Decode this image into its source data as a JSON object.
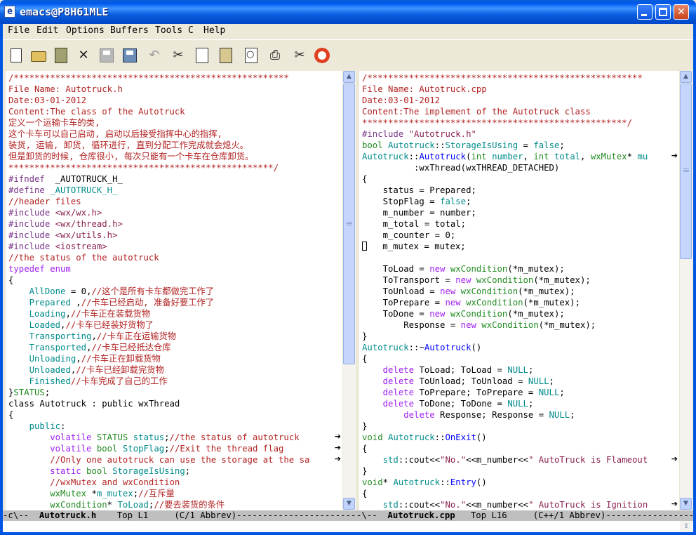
{
  "window": {
    "title": "emacs@P8H61MLE",
    "icon": "emacs-icon"
  },
  "menu": [
    "File",
    "Edit",
    "Options",
    "Buffers",
    "Tools",
    "C",
    "Help"
  ],
  "toolbar": [
    {
      "name": "new-file-icon"
    },
    {
      "name": "open-folder-icon"
    },
    {
      "name": "dired-icon"
    },
    {
      "name": "close-icon",
      "glyph": "✕"
    },
    {
      "name": "save-icon"
    },
    {
      "name": "save-as-icon"
    },
    {
      "name": "undo-icon",
      "glyph": "↶"
    },
    {
      "name": "cut-icon",
      "glyph": "✂"
    },
    {
      "name": "copy-icon"
    },
    {
      "name": "paste-icon"
    },
    {
      "name": "search-icon",
      "glyph": "🔍"
    },
    {
      "name": "print-icon",
      "glyph": "⎙"
    },
    {
      "name": "preferences-icon",
      "glyph": "✂"
    },
    {
      "name": "help-icon"
    }
  ],
  "left_buffer": {
    "lines": [
      [
        [
          "cmt",
          "/*****************************************************"
        ]
      ],
      [
        [
          "cmt",
          "File Name: Autotruck.h"
        ]
      ],
      [
        [
          "cmt",
          "Date:03-01-2012"
        ]
      ],
      [
        [
          "cmt",
          "Content:The class of the Autotruck"
        ]
      ],
      [
        [
          "cmt",
          "定义一个运输卡车的类,"
        ]
      ],
      [
        [
          "cmt",
          "这个卡车可以自己启动, 启动以后接受指挥中心的指挥,"
        ]
      ],
      [
        [
          "cmt",
          "装货, 运输, 卸货, 循环进行, 直到分配工作完成就会熄火。"
        ]
      ],
      [
        [
          "cmt",
          "但是卸货的时候, 仓库很小, 每次只能有一个卡车在仓库卸货。"
        ]
      ],
      [
        [
          "cmt",
          "***************************************************/"
        ]
      ],
      [
        [
          "pp",
          "#ifndef"
        ],
        [
          "",
          "  _AUTOTRUCK_H_"
        ]
      ],
      [
        [
          "pp",
          "#define"
        ],
        [
          "cn",
          " _AUTOTRUCK_H_"
        ]
      ],
      [
        [
          "cmt",
          "//header files"
        ]
      ],
      [
        [
          "pp",
          "#include"
        ],
        [
          "str",
          " <wx/wx.h>"
        ]
      ],
      [
        [
          "pp",
          "#include"
        ],
        [
          "str",
          " <wx/thread.h>"
        ]
      ],
      [
        [
          "pp",
          "#include"
        ],
        [
          "str",
          " <wx/utils.h>"
        ]
      ],
      [
        [
          "pp",
          "#include"
        ],
        [
          "str",
          " <iostream>"
        ]
      ],
      [
        [
          "cmt",
          "//the status of the autotruck"
        ]
      ],
      [
        [
          "kw",
          "typedef enum"
        ]
      ],
      [
        [
          "",
          "{"
        ]
      ],
      [
        [
          "",
          "    "
        ],
        [
          "cn",
          "AllDone"
        ],
        [
          "",
          " = 0,"
        ],
        [
          "cmt",
          "//这个是所有卡车都做完工作了"
        ]
      ],
      [
        [
          "",
          "    "
        ],
        [
          "cn",
          "Prepared"
        ],
        [
          "",
          " ,"
        ],
        [
          "cmt",
          "//卡车已经启动, 准备好要工作了"
        ]
      ],
      [
        [
          "",
          "    "
        ],
        [
          "cn",
          "Loading"
        ],
        [
          "",
          ","
        ],
        [
          "cmt",
          "//卡车正在装载货物"
        ]
      ],
      [
        [
          "",
          "    "
        ],
        [
          "cn",
          "Loaded"
        ],
        [
          "",
          ","
        ],
        [
          "cmt",
          "//卡车已经装好货物了"
        ]
      ],
      [
        [
          "",
          "    "
        ],
        [
          "cn",
          "Transporting"
        ],
        [
          "",
          ","
        ],
        [
          "cmt",
          "//卡车正在运输货物"
        ]
      ],
      [
        [
          "",
          "    "
        ],
        [
          "cn",
          "Transported"
        ],
        [
          "",
          ","
        ],
        [
          "cmt",
          "//卡车已经抵达仓库"
        ]
      ],
      [
        [
          "",
          "    "
        ],
        [
          "cn",
          "Unloading"
        ],
        [
          "",
          ","
        ],
        [
          "cmt",
          "//卡车正在卸载货物"
        ]
      ],
      [
        [
          "",
          "    "
        ],
        [
          "cn",
          "Unloaded"
        ],
        [
          "",
          ","
        ],
        [
          "cmt",
          "//卡车已经卸载完货物"
        ]
      ],
      [
        [
          "",
          "    "
        ],
        [
          "cn",
          "Finished"
        ],
        [
          "",
          ""
        ],
        [
          "cmt",
          "//卡车完成了自己的工作"
        ]
      ],
      [
        [
          "",
          "}"
        ],
        [
          "ty",
          "STATUS"
        ],
        [
          "",
          ";"
        ]
      ],
      [
        [
          "",
          "class Autotruck : public wxThread"
        ]
      ],
      [
        [
          "",
          "{"
        ]
      ],
      [
        [
          "",
          "    "
        ],
        [
          "cn",
          "public"
        ],
        [
          "",
          ":"
        ]
      ],
      [
        [
          "",
          "        "
        ],
        [
          "kw",
          "volatile"
        ],
        [
          "ty",
          " STATUS"
        ],
        [
          "cn",
          " status"
        ],
        [
          "",
          ";"
        ],
        [
          "cmt",
          "//the status of autotruck"
        ]
      ],
      [
        [
          "",
          "        "
        ],
        [
          "kw",
          "volatile"
        ],
        [
          "ty",
          " bool"
        ],
        [
          "cn",
          " StopFlag"
        ],
        [
          "",
          ";"
        ],
        [
          "cmt",
          "//Exit the thread flag"
        ]
      ],
      [
        [
          "",
          "        "
        ],
        [
          "cmt",
          "//Only one autotruck can use the storage at the sa"
        ]
      ],
      [
        [
          "",
          "        "
        ],
        [
          "kw",
          "static"
        ],
        [
          "ty",
          " bool"
        ],
        [
          "cn",
          " StorageIsUsing"
        ],
        [
          "",
          ";"
        ]
      ],
      [
        [
          "",
          "        "
        ],
        [
          "cmt",
          "//wxMutex and wxCondition"
        ]
      ],
      [
        [
          "",
          "        "
        ],
        [
          "ty",
          "wxMutex"
        ],
        [
          "",
          " *"
        ],
        [
          "cn",
          "m_mutex"
        ],
        [
          "",
          ";"
        ],
        [
          "cmt",
          "//互斥量"
        ]
      ],
      [
        [
          "",
          "        "
        ],
        [
          "ty",
          "wxCondition"
        ],
        [
          "",
          "* "
        ],
        [
          "cn",
          "ToLoad"
        ],
        [
          "",
          ";"
        ],
        [
          "cmt",
          "//要去装货的条件"
        ]
      ]
    ],
    "wrapped_lines": [
      32,
      33,
      34
    ]
  },
  "right_buffer": {
    "lines": [
      [
        [
          "cmt",
          "/*****************************************************"
        ]
      ],
      [
        [
          "cmt",
          "File Name: Autotruck.cpp"
        ]
      ],
      [
        [
          "cmt",
          "Date:03-01-2012"
        ]
      ],
      [
        [
          "cmt",
          "Content:The implement of the Autotruck class"
        ]
      ],
      [
        [
          "cmt",
          "***************************************************/"
        ]
      ],
      [
        [
          "pp",
          "#include"
        ],
        [
          "str",
          " \"Autotruck.h\""
        ]
      ],
      [
        [
          "ty",
          "bool"
        ],
        [
          "cn",
          " Autotruck"
        ],
        [
          "",
          "::"
        ],
        [
          "cn",
          "StorageIsUsing"
        ],
        [
          "",
          " = "
        ],
        [
          "cn",
          "false"
        ],
        [
          "",
          ";"
        ]
      ],
      [
        [
          "cn",
          "Autotruck"
        ],
        [
          "",
          "::"
        ],
        [
          "fn",
          "Autotruck"
        ],
        [
          "",
          "("
        ],
        [
          "ty",
          "int"
        ],
        [
          "cn",
          " number"
        ],
        [
          ",",
          ""
        ],
        [
          "",
          ", "
        ],
        [
          "ty",
          "int"
        ],
        [
          "cn",
          " total"
        ],
        [
          "",
          ", "
        ],
        [
          "ty",
          "wxMutex"
        ],
        [
          "",
          "* "
        ],
        [
          "cn",
          "mu"
        ]
      ],
      [
        [
          "",
          "          :wxThread(wxTHREAD_DETACHED)"
        ]
      ],
      [
        [
          "",
          "{"
        ]
      ],
      [
        [
          "",
          "    status = Prepared;"
        ]
      ],
      [
        [
          "",
          "    StopFlag = "
        ],
        [
          "cn",
          "false"
        ],
        [
          "",
          ";"
        ]
      ],
      [
        [
          "",
          "    m_number = number;"
        ]
      ],
      [
        [
          "",
          "    m_total = total;"
        ]
      ],
      [
        [
          "",
          "    m_counter = 0;"
        ]
      ],
      [
        [
          "cursor",
          ""
        ],
        [
          "",
          "   m_mutex = mutex;"
        ]
      ],
      [
        [
          "",
          ""
        ]
      ],
      [
        [
          "",
          "    ToLoad = "
        ],
        [
          "kw",
          "new"
        ],
        [
          "ty",
          " wxCondition"
        ],
        [
          "",
          "(*m_mutex);"
        ]
      ],
      [
        [
          "",
          "    ToTransport = "
        ],
        [
          "kw",
          "new"
        ],
        [
          "ty",
          " wxCondition"
        ],
        [
          "",
          "(*m_mutex);"
        ]
      ],
      [
        [
          "",
          "    ToUnload = "
        ],
        [
          "kw",
          "new"
        ],
        [
          "ty",
          " wxCondition"
        ],
        [
          "",
          "(*m_mutex);"
        ]
      ],
      [
        [
          "",
          "    ToPrepare = "
        ],
        [
          "kw",
          "new"
        ],
        [
          "ty",
          " wxCondition"
        ],
        [
          "",
          "(*m_mutex);"
        ]
      ],
      [
        [
          "",
          "    ToDone = "
        ],
        [
          "kw",
          "new"
        ],
        [
          "ty",
          " wxCondition"
        ],
        [
          "",
          "(*m_mutex);"
        ]
      ],
      [
        [
          "",
          "        Response = "
        ],
        [
          "kw",
          "new"
        ],
        [
          "ty",
          " wxCondition"
        ],
        [
          "",
          "(*m_mutex);"
        ]
      ],
      [
        [
          "",
          "}"
        ]
      ],
      [
        [
          "cn",
          "Autotruck"
        ],
        [
          "",
          "::~"
        ],
        [
          "fn",
          "Autotruck"
        ],
        [
          "",
          "()"
        ]
      ],
      [
        [
          "",
          "{"
        ]
      ],
      [
        [
          "",
          "    "
        ],
        [
          "kw",
          "delete"
        ],
        [
          "",
          " ToLoad; ToLoad = "
        ],
        [
          "cn",
          "NULL"
        ],
        [
          "",
          ";"
        ]
      ],
      [
        [
          "",
          "    "
        ],
        [
          "kw",
          "delete"
        ],
        [
          "",
          " ToUnload; ToUnload = "
        ],
        [
          "cn",
          "NULL"
        ],
        [
          "",
          ";"
        ]
      ],
      [
        [
          "",
          "    "
        ],
        [
          "kw",
          "delete"
        ],
        [
          "",
          " ToPrepare; ToPrepare = "
        ],
        [
          "cn",
          "NULL"
        ],
        [
          "",
          ";"
        ]
      ],
      [
        [
          "",
          "    "
        ],
        [
          "kw",
          "delete"
        ],
        [
          "",
          " ToDone; ToDone = "
        ],
        [
          "cn",
          "NULL"
        ],
        [
          "",
          ";"
        ]
      ],
      [
        [
          "",
          "        "
        ],
        [
          "kw",
          "delete"
        ],
        [
          "",
          " Response; Response = "
        ],
        [
          "cn",
          "NULL"
        ],
        [
          "",
          ";"
        ]
      ],
      [
        [
          "",
          "}"
        ]
      ],
      [
        [
          "ty",
          "void"
        ],
        [
          "cn",
          " Autotruck"
        ],
        [
          "",
          "::"
        ],
        [
          "fn",
          "OnExit"
        ],
        [
          "",
          "()"
        ]
      ],
      [
        [
          "",
          "{"
        ]
      ],
      [
        [
          "",
          "    "
        ],
        [
          "cn",
          "std"
        ],
        [
          "",
          "::cout<<"
        ],
        [
          "str",
          "\"No.\""
        ],
        [
          "",
          "<<m_number<<"
        ],
        [
          "str",
          "\" AutoTruck is Flameout"
        ]
      ],
      [
        [
          "",
          "}"
        ]
      ],
      [
        [
          "ty",
          "void"
        ],
        [
          "",
          "* "
        ],
        [
          "cn",
          "Autotruck"
        ],
        [
          "",
          "::"
        ],
        [
          "fn",
          "Entry"
        ],
        [
          "",
          "()"
        ]
      ],
      [
        [
          "",
          "{"
        ]
      ],
      [
        [
          "",
          "    "
        ],
        [
          "cn",
          "std"
        ],
        [
          "",
          "::cout<<"
        ],
        [
          "str",
          "\"No.\""
        ],
        [
          "",
          "<<m_number<<"
        ],
        [
          "str",
          "\" AutoTruck is Ignition"
        ]
      ]
    ],
    "wrapped_lines": [
      7,
      34,
      38
    ]
  },
  "modeline_left": {
    "prefix": "-c\\--  ",
    "buffer": "Autotruck.h",
    "rest": "    Top L1     (C/1 Abbrev)-----------------------"
  },
  "modeline_right": {
    "prefix": "-\\--  ",
    "buffer": "Autotruck.cpp",
    "rest": "   Top L16     (C++/1 Abbrev)-----------------------"
  }
}
